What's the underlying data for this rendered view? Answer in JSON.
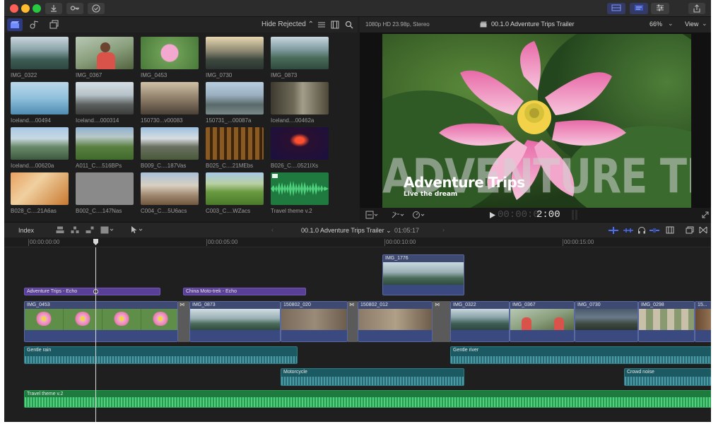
{
  "colors": {
    "accent": "#4a6cf7",
    "storyline": "#4b5a8a",
    "audio": "#1c5a63",
    "music": "#1f7a3f",
    "title": "#5a3f96"
  },
  "browser": {
    "filter": "Hide Rejected ⌃",
    "clips": [
      {
        "label": "IMG_0322"
      },
      {
        "label": "IMG_0367"
      },
      {
        "label": "IMG_0453"
      },
      {
        "label": "IMG_0730"
      },
      {
        "label": "IMG_0873"
      },
      {
        "label": "Iceland....00494"
      },
      {
        "label": "Iceland....000314"
      },
      {
        "label": "150730...v00083"
      },
      {
        "label": "150731_...00087a"
      },
      {
        "label": "Iceland....00462a"
      },
      {
        "label": "Iceland....00620a"
      },
      {
        "label": "A011_C....516BPs"
      },
      {
        "label": "B009_C....187Vas"
      },
      {
        "label": "B025_C....21MEbs"
      },
      {
        "label": "B026_C....0521IXs"
      },
      {
        "label": "B028_C....21A6as"
      },
      {
        "label": "B002_C....147Nas"
      },
      {
        "label": "C004_C....5U6acs"
      },
      {
        "label": "C003_C....WZacs"
      },
      {
        "label": "Travel theme v.2"
      }
    ]
  },
  "viewer": {
    "format": "1080p HD 23.98p, Stereo",
    "project": "00.1.0 Adventure Trips Trailer",
    "zoom": "66%",
    "view": "View",
    "title_main": "Adventure Trips",
    "title_sub": "Live the dream",
    "bg_text": "ADVENTURE TRIPS",
    "timecode_dim": "00:00:0",
    "timecode": "2:00"
  },
  "timeline": {
    "index_label": "Index",
    "project": "00.1.0 Adventure Trips Trailer ⌄",
    "duration": "01:05:17",
    "ruler": [
      "00:00:00:00",
      "00:00:05:00",
      "00:00:10:00",
      "00:00:15:00"
    ],
    "connected_clip": "IMG_1776",
    "titles": [
      "Adventure Trips - Echo",
      "China Moto-trek - Echo"
    ],
    "primary": [
      "IMG_0453",
      "IMG_0873",
      "150802_020",
      "150802_012",
      "IMG_0322",
      "IMG_0367",
      "IMG_0730",
      "IMG_0298",
      "15..."
    ],
    "audio": [
      "Gentle rain",
      "Gentle river",
      "Motorcycle",
      "Crowd noise"
    ],
    "music": "Travel theme v.2"
  }
}
